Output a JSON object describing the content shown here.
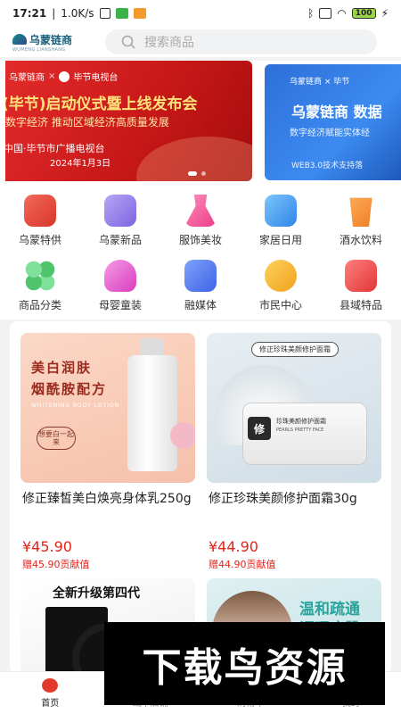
{
  "status_bar": {
    "time": "17:21",
    "net_speed": "1.0K/s",
    "battery": "100"
  },
  "header": {
    "logo_text": "乌蒙链商",
    "logo_sub": "WUMENG LIANSHANG",
    "search_placeholder": "搜索商品"
  },
  "banners": [
    {
      "brand_left": "乌蒙链商",
      "brand_right": "毕节电视台",
      "title": "(毕节)启动仪式暨上线发布会",
      "subtitle": "数字经济  推动区域经济高质量发展",
      "org": "中国·毕节市广播电视台",
      "date": "2024年1月3日"
    },
    {
      "brand_left": "乌蒙链商",
      "brand_right": "毕节",
      "title": "乌蒙链商 数据",
      "subtitle": "数字经济赋能实体经",
      "footer": "WEB3.0技术支持落"
    }
  ],
  "categories": [
    {
      "label": "乌蒙特供",
      "color": "#e8443a"
    },
    {
      "label": "乌蒙新品",
      "color": "#8d72e6"
    },
    {
      "label": "服饰美妆",
      "color": "#f25b9a"
    },
    {
      "label": "家居日用",
      "color": "#3f9ff0"
    },
    {
      "label": "酒水饮料",
      "color": "#f28a2a"
    },
    {
      "label": "商品分类",
      "color": "#4fc46c"
    },
    {
      "label": "母婴童装",
      "color": "#e755c9"
    },
    {
      "label": "融媒体",
      "color": "#4f7cf0"
    },
    {
      "label": "市民中心",
      "color": "#f5b52d"
    },
    {
      "label": "县域特品",
      "color": "#ef4a4a"
    }
  ],
  "products": [
    {
      "title": "修正臻皙美白焕亮身体乳250g",
      "price": "¥45.90",
      "contribution": "赠45.90贡献值",
      "img_t1": "美白润肤",
      "img_t2": "烟酰胺配方",
      "img_t3": "WHITENING BODY LOTION",
      "img_seal": "想要白一起来"
    },
    {
      "title": "修正珍珠美颜修护面霜30g",
      "price": "¥44.90",
      "contribution": "赠44.90贡献值",
      "img_tag": "修正珍珠美颜修护面霜",
      "img_label": "珍珠美颜修护面霜",
      "img_sub": "PEARLS PRETTY FACE",
      "img_brand": "修"
    },
    {
      "img_t": "全新升级第四代"
    },
    {
      "img_t1": "温和疏通",
      "img_t2": "调理痘肌"
    }
  ],
  "tabbar": [
    {
      "label": "首页",
      "active": true
    },
    {
      "label": "线下店铺",
      "active": false
    },
    {
      "label": "购物车",
      "active": false
    },
    {
      "label": "我的",
      "active": false
    }
  ],
  "watermark": "下载鸟资源"
}
